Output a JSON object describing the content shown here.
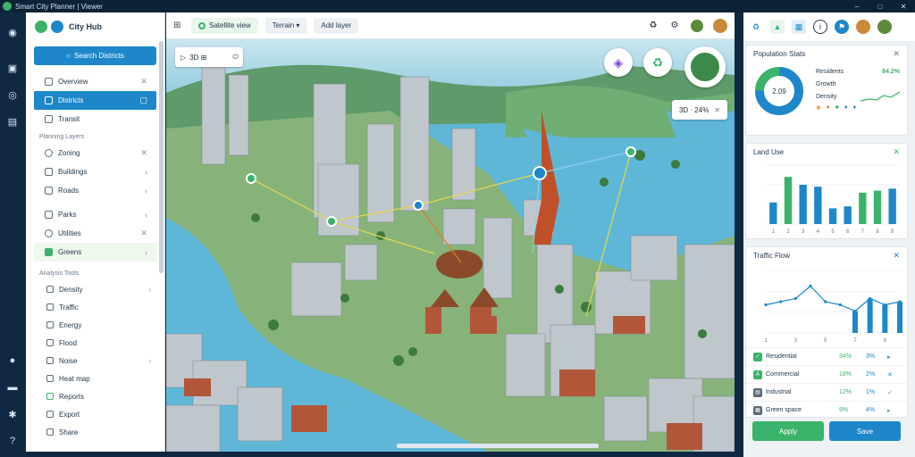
{
  "window": {
    "title": "Smart City Planner | Viewer",
    "minimize": "–",
    "maximize": "□",
    "close": "✕"
  },
  "left_panel": {
    "brand": "City Hub",
    "search_label": "Search Districts",
    "items": [
      {
        "label": "Overview",
        "trail": "✕"
      },
      {
        "label": "Districts",
        "trail": "▢"
      },
      {
        "label": "Transit",
        "trail": ""
      }
    ],
    "section1": "Planning Layers",
    "items2": [
      {
        "label": "Zoning",
        "trail": "✕"
      },
      {
        "label": "Buildings",
        "trail": "›"
      },
      {
        "label": "Roads",
        "trail": "›"
      },
      {
        "label": "Parks",
        "trail": "›"
      },
      {
        "label": "Utilities",
        "trail": "✕"
      },
      {
        "label": "Greens",
        "trail": "›"
      }
    ],
    "section2": "Analysis Tools",
    "sub_items": [
      {
        "label": "Density",
        "trail": "›"
      },
      {
        "label": "Traffic",
        "trail": ""
      },
      {
        "label": "Energy",
        "trail": ""
      },
      {
        "label": "Flood",
        "trail": ""
      },
      {
        "label": "Noise",
        "trail": "›"
      },
      {
        "label": "Heat map",
        "trail": ""
      },
      {
        "label": "Reports",
        "trail": ""
      },
      {
        "label": "Export",
        "trail": ""
      },
      {
        "label": "Share",
        "trail": ""
      }
    ]
  },
  "toolbar": {
    "btn1": "Satellite view",
    "btn2": "Terrain ▾",
    "btn3": "Add layer"
  },
  "map": {
    "ctrl_label": "3D ⊞",
    "coord_label": "3D · 24%"
  },
  "right_panel": {
    "card1": {
      "title": "Population Stats",
      "center": "2.09",
      "rows": [
        {
          "l": "Residents",
          "v": "84.2%"
        },
        {
          "l": "Growth",
          "v": ""
        },
        {
          "l": "Density",
          "v": ""
        }
      ]
    },
    "card2": {
      "title": "Land Use"
    },
    "card3": {
      "title": "Traffic Flow"
    },
    "table": [
      {
        "ic": "✓",
        "name": "Residential",
        "a": "34%",
        "b": "3%",
        "c": "▸"
      },
      {
        "ic": "A",
        "name": "Commercial",
        "a": "18%",
        "b": "2%",
        "c": "✕"
      },
      {
        "ic": "▤",
        "name": "Industrial",
        "a": "12%",
        "b": "1%",
        "c": "✓"
      },
      {
        "ic": "▦",
        "name": "Green space",
        "a": "9%",
        "b": "4%",
        "c": "▸"
      }
    ],
    "btn_apply": "Apply",
    "btn_save": "Save"
  },
  "chart_data": [
    {
      "type": "bar",
      "categories": [
        "1",
        "2",
        "3",
        "4",
        "5",
        "6",
        "7",
        "8",
        "9"
      ],
      "series": [
        {
          "values": [
            22,
            48,
            40,
            38,
            16,
            18,
            32,
            34,
            36
          ]
        }
      ],
      "ylim": [
        0,
        60
      ]
    },
    {
      "type": "line",
      "x": [
        1,
        2,
        3,
        4,
        5,
        6,
        7,
        8,
        9,
        10
      ],
      "series": [
        {
          "values": [
            18,
            20,
            22,
            30,
            20,
            18,
            14,
            22,
            18,
            20
          ]
        }
      ],
      "ylim": [
        0,
        40
      ]
    }
  ],
  "colors": {
    "accent": "#1d87c9",
    "green": "#3bb36b",
    "dark": "#0f2942"
  }
}
